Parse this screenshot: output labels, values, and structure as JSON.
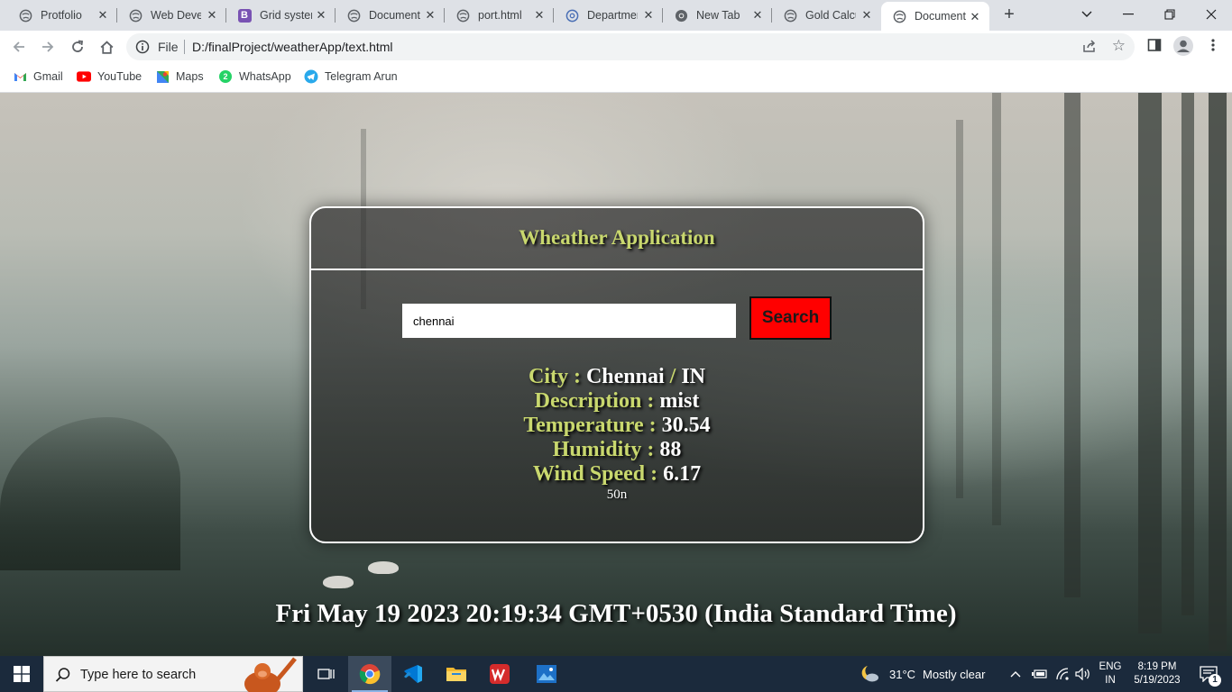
{
  "browser": {
    "tabs": [
      {
        "title": "Protfolio",
        "icon": "globe-icon"
      },
      {
        "title": "Web Devel",
        "icon": "globe-icon"
      },
      {
        "title": "Grid systen",
        "icon": "bootstrap-icon"
      },
      {
        "title": "Document",
        "icon": "globe-icon"
      },
      {
        "title": "port.html",
        "icon": "globe-icon"
      },
      {
        "title": "Departmer",
        "icon": "settings-globe-icon"
      },
      {
        "title": "New Tab",
        "icon": "chrome-icon"
      },
      {
        "title": "Gold Calcu",
        "icon": "globe-icon"
      },
      {
        "title": "Document",
        "icon": "globe-icon",
        "active": true
      }
    ],
    "address": {
      "scheme_label": "File",
      "url": "D:/finalProject/weatherApp/text.html"
    },
    "bookmarks": [
      {
        "label": "Gmail",
        "icon": "gmail-icon"
      },
      {
        "label": "YouTube",
        "icon": "youtube-icon"
      },
      {
        "label": "Maps",
        "icon": "maps-icon"
      },
      {
        "label": "WhatsApp",
        "icon": "whatsapp-icon"
      },
      {
        "label": "Telegram Arun",
        "icon": "telegram-icon"
      }
    ]
  },
  "app": {
    "title": "Wheather Application",
    "search": {
      "value": "chennai",
      "button_label": "Search"
    },
    "results": {
      "city_label": "City : ",
      "city_value": "Chennai",
      "country_sep": " / ",
      "country_value": "IN",
      "description_label": "Description : ",
      "description_value": "mist",
      "temperature_label": "Temperature : ",
      "temperature_value": "30.54",
      "humidity_label": "Humidity : ",
      "humidity_value": "88",
      "wind_label": "Wind Speed : ",
      "wind_value": "6.17",
      "extra": "50n"
    },
    "datetime": "Fri May 19 2023 20:19:34 GMT+0530 (India Standard Time)"
  },
  "taskbar": {
    "search_placeholder": "Type here to search",
    "weather_temp": "31°C",
    "weather_desc": "Mostly clear",
    "lang_top": "ENG",
    "lang_bottom": "IN",
    "time": "8:19 PM",
    "date": "5/19/2023",
    "notification_count": "1"
  },
  "colors": {
    "accent_label": "#c9d86e",
    "search_button": "#ff0000",
    "taskbar": "#1b2a3c"
  }
}
